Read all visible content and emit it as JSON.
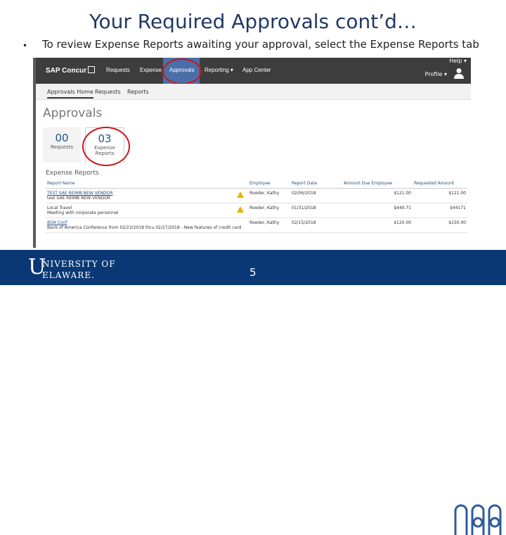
{
  "slide": {
    "title": "Your Required Approvals cont’d…",
    "bullet": "•",
    "instruction": "To review Expense Reports awaiting your approval, select the Expense Reports tab",
    "page_number": "5"
  },
  "app": {
    "logo": "SAP Concur",
    "nav": [
      "Requests",
      "Expense",
      "Approvals",
      "Reporting ▾",
      "App Center"
    ],
    "active_nav": "Approvals",
    "help": "Help ▾",
    "profile": "Profile ▾",
    "subnav": [
      "Approvals Home",
      "Requests",
      "Reports"
    ],
    "page_heading": "Approvals",
    "tiles": [
      {
        "count": "00",
        "label": "Requests"
      },
      {
        "count": "03",
        "label": "Expense Reports"
      }
    ],
    "section_heading": "Expense Reports",
    "table": {
      "headers": [
        "Report Name",
        "Employee",
        "Report Date",
        "Amount Due Employee",
        "Requested Amount"
      ],
      "rows": [
        {
          "name": "TEST SAE REIMB NEW VENDOR",
          "sub": "test SAE REIMB NEW VENDOR",
          "employee": "Roeder, Kathy",
          "date": "02/06/2018",
          "due": "$121.00",
          "requested": "$121.00"
        },
        {
          "name": "Local Travel",
          "sub": "Meeting with corporate personnel",
          "employee": "Roeder, Kathy",
          "date": "01/31/2018",
          "due": "$440.71",
          "requested": "$44171"
        },
        {
          "name": "BOA Conf",
          "sub": "Bank of America Conference from 02/23/2018 thru 02/27/2018 - New features of credit card",
          "employee": "Roeder, Kathy",
          "date": "02/15/2018",
          "due": "$120.00",
          "requested": "$150.00"
        }
      ]
    }
  },
  "footer": {
    "logo_initial": "U",
    "logo_line1": "NIVERSITY OF",
    "logo_line2": "ELAWARE.",
    "background": "#0a3875"
  },
  "colors": {
    "title": "#1f3864",
    "nav_bg": "#3d3d3d",
    "highlight": "#d0141a",
    "link": "#24518b"
  }
}
